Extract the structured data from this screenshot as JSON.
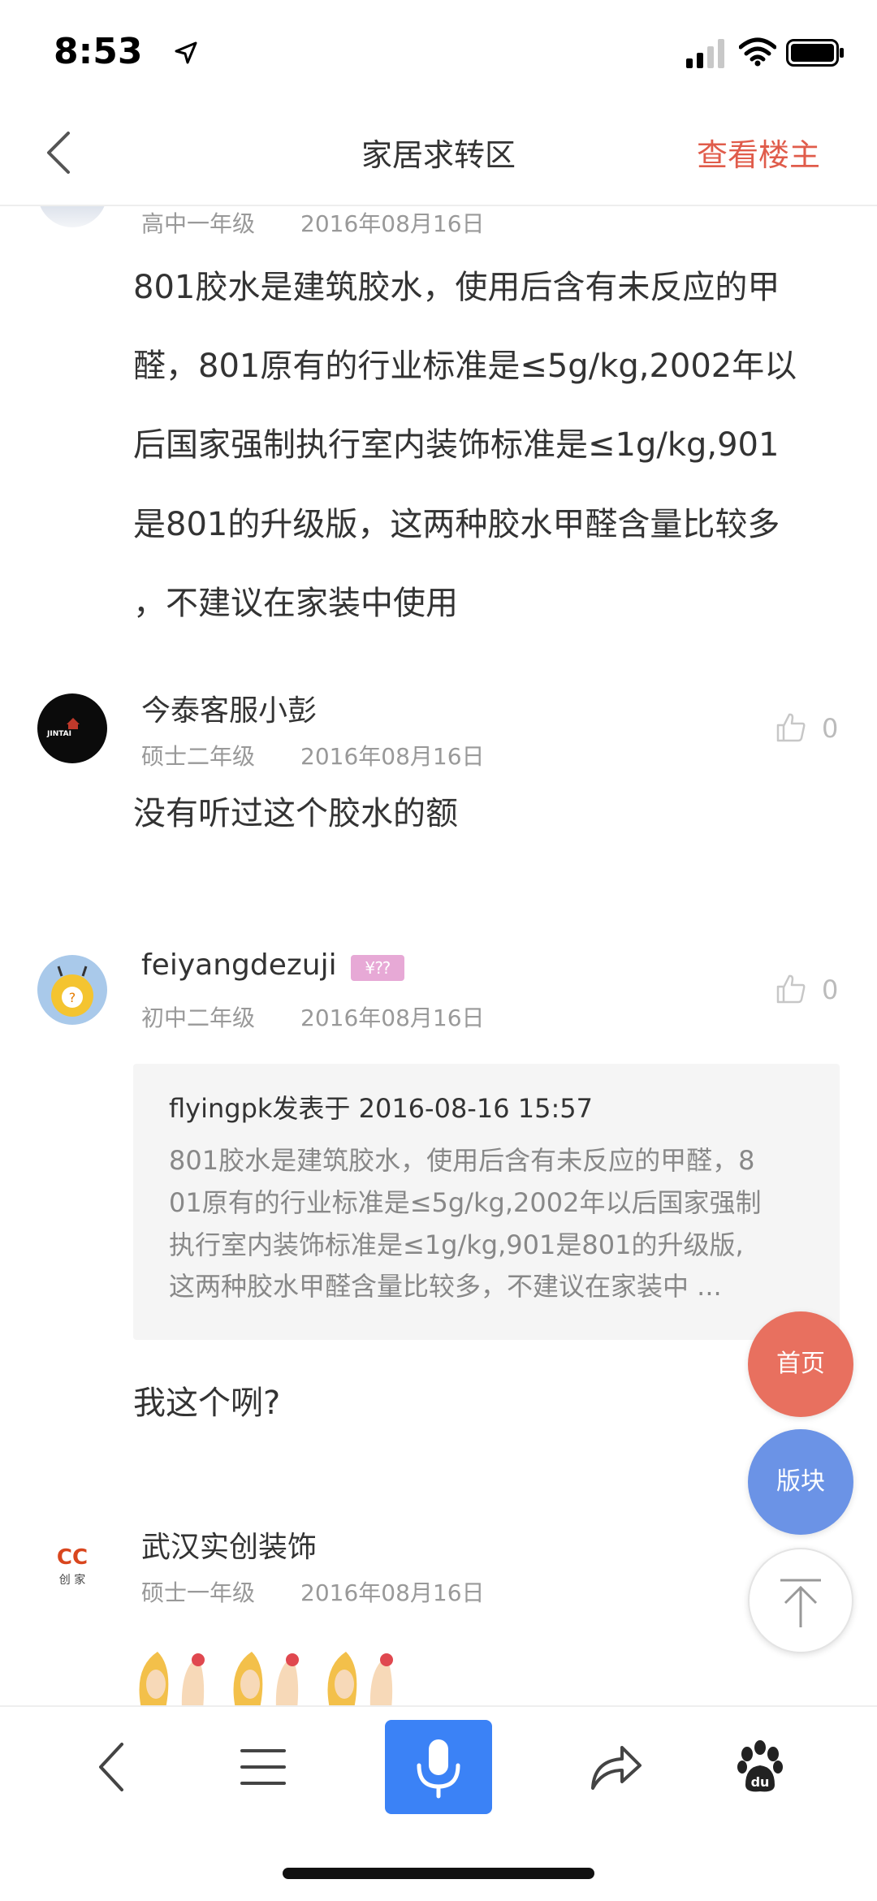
{
  "status_bar": {
    "time": "8:53"
  },
  "nav": {
    "title": "家居求转区",
    "op_only": "查看楼主"
  },
  "posts": [
    {
      "level": "高中一年级",
      "date": "2016年08月16日",
      "lines": [
        "801胶水是建筑胶水，使用后含有未反应的甲",
        "醛，801原有的行业标准是≤5g/kg,2002年以",
        "后国家强制执行室内装饰标准是≤1g/kg,901",
        "是801的升级版，这两种胶水甲醛含量比较多",
        "，不建议在家装中使用"
      ]
    },
    {
      "name": "今泰客服小彭",
      "level": "硕士二年级",
      "date": "2016年08月16日",
      "likes": "0",
      "text": "没有听过这个胶水的额",
      "avatar_text": "JINTAI"
    },
    {
      "name": "feiyangdezuji",
      "badge": "¥⁇",
      "level": "初中二年级",
      "date": "2016年08月16日",
      "likes": "0",
      "quote": {
        "header": "flyingpk发表于 2016-08-16 15:57",
        "lines": [
          "801胶水是建筑胶水，使用后含有未反应的甲醛，8",
          "01原有的行业标准是≤5g/kg,2002年以后国家强制",
          "执行室内装饰标准是≤1g/kg,901是801的升级版,",
          "这两种胶水甲醛含量比较多，不建议在家装中 ..."
        ]
      },
      "text": "我这个咧?"
    },
    {
      "name": "武汉实创装饰",
      "level": "硕士一年级",
      "date": "2016年08月16日",
      "avatar_text_top": "CC",
      "avatar_text_bottom": "创 家"
    }
  ],
  "fabs": {
    "home": "首页",
    "section": "版块"
  },
  "colors": {
    "accent_red": "#e8705f",
    "accent_blue": "#6b93e6",
    "mic_blue": "#3b82f6",
    "op_red": "#e05c4b"
  },
  "icons": [
    "location-arrow-icon",
    "signal-icon",
    "wifi-icon",
    "battery-icon",
    "back-chevron-icon",
    "thumb-up-icon",
    "arrow-up-icon",
    "menu-icon",
    "microphone-icon",
    "share-icon",
    "baidu-paw-icon"
  ]
}
